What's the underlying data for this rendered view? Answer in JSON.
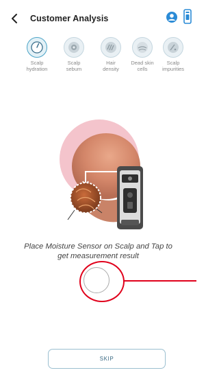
{
  "header": {
    "title": "Customer Analysis",
    "back_icon": "chevron-left-icon",
    "user_icon": "user-circle-icon",
    "device_icon": "device-icon"
  },
  "categories": [
    {
      "label_l1": "Scalp",
      "label_l2": "hydration",
      "icon": "hydration-gauge-icon",
      "active": true
    },
    {
      "label_l1": "Scalp",
      "label_l2": "sebum",
      "icon": "sebum-icon",
      "active": false
    },
    {
      "label_l1": "Hair",
      "label_l2": "density",
      "icon": "hair-density-icon",
      "active": false
    },
    {
      "label_l1": "Dead skin",
      "label_l2": "cells",
      "icon": "dead-skin-icon",
      "active": false
    },
    {
      "label_l1": "Scalp",
      "label_l2": "impurities",
      "icon": "impurities-icon",
      "active": false
    }
  ],
  "instructions": {
    "line1": "Place Moisture Sensor on Scalp and Tap to",
    "line2": "get measurement result"
  },
  "skip_label": "SKIP",
  "colors": {
    "accent": "#4aa3c6",
    "highlight": "#e0001b",
    "illustration_circle": "#f4c4cc"
  }
}
